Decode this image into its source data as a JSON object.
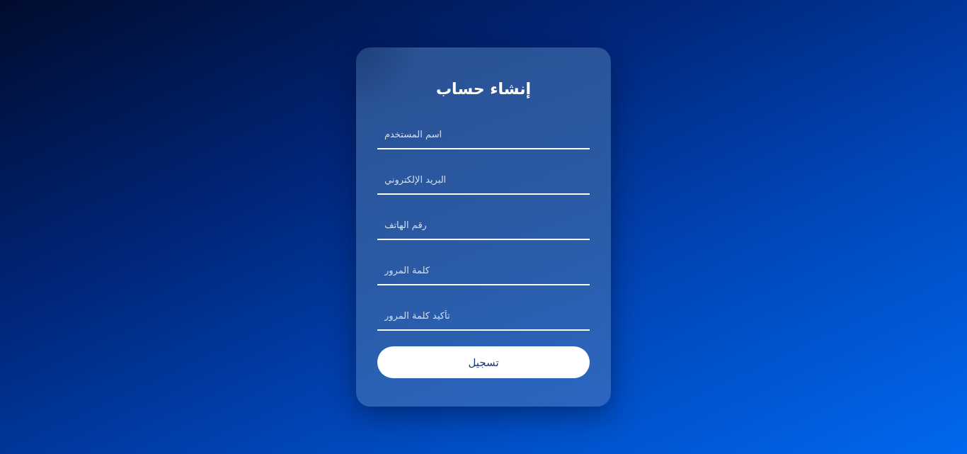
{
  "title": "إنشاء حساب",
  "fields": [
    {
      "placeholder": "اسم المستخدم"
    },
    {
      "placeholder": "البريد الإلكتروني"
    },
    {
      "placeholder": "رقم الهاتف"
    },
    {
      "placeholder": "كلمة المرور"
    },
    {
      "placeholder": "تأكيد كلمة المرور"
    }
  ],
  "submit_button": {
    "label": "تسجيل"
  }
}
